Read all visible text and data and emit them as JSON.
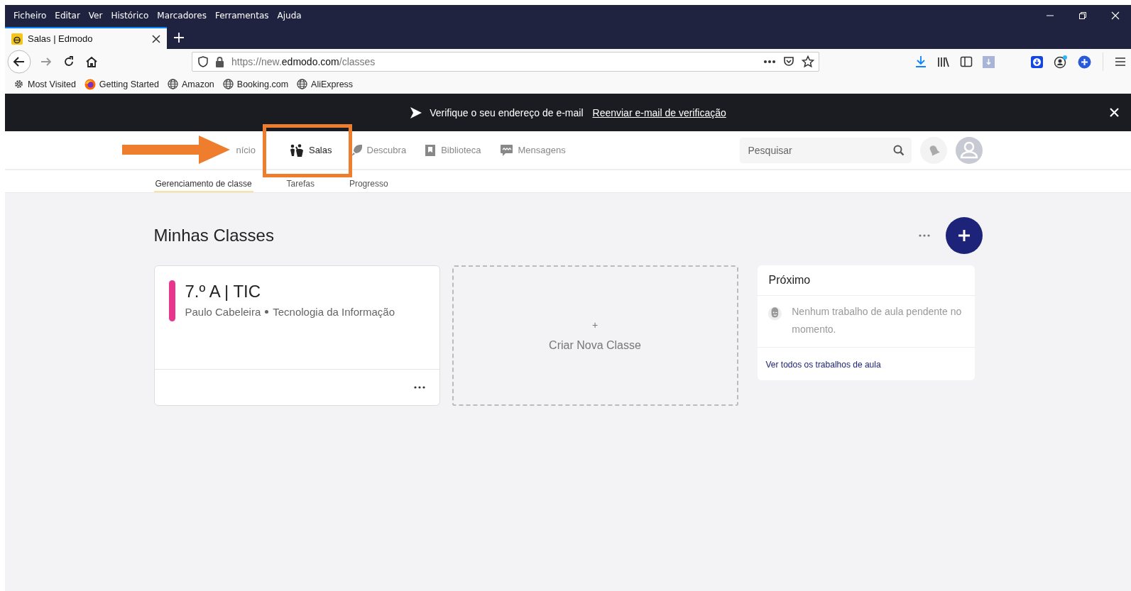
{
  "browser": {
    "menu": [
      "Ficheiro",
      "Editar",
      "Ver",
      "Histórico",
      "Marcadores",
      "Ferramentas",
      "Ajuda"
    ],
    "tab": {
      "title": "Salas | Edmodo",
      "selected": true
    },
    "url": {
      "prefix": "https://new.",
      "domain": "edmodo.com",
      "path": "/classes"
    },
    "bookmarks": [
      {
        "label": "Most Visited",
        "kind": "gear"
      },
      {
        "label": "Getting Started",
        "kind": "firefox"
      },
      {
        "label": "Amazon",
        "kind": "globe"
      },
      {
        "label": "Booking.com",
        "kind": "globe"
      },
      {
        "label": "AliExpress",
        "kind": "globe"
      }
    ]
  },
  "banner": {
    "message": "Verifique o seu endereço de e-mail",
    "link": "Reenviar e-mail de verificação"
  },
  "header": {
    "nav": [
      {
        "label": "nício",
        "selected": false,
        "highlighted": false
      },
      {
        "label": "Salas",
        "selected": true,
        "highlighted": true
      },
      {
        "label": "Descubra",
        "selected": false,
        "highlighted": false
      },
      {
        "label": "Biblioteca",
        "selected": false,
        "highlighted": false
      },
      {
        "label": "Mensagens",
        "selected": false,
        "highlighted": false
      }
    ],
    "search": {
      "placeholder": "Pesquisar"
    }
  },
  "subnav": [
    {
      "label": "Gerenciamento de classe",
      "selected": true
    },
    {
      "label": "Tarefas",
      "selected": false
    },
    {
      "label": "Progresso",
      "selected": false
    }
  ],
  "page": {
    "title": "Minhas Classes",
    "classes": [
      {
        "name": "7.º A | TIC",
        "teacher": "Paulo Cabeleira",
        "subject": "Tecnologia da Informação",
        "color": "#e8368f"
      }
    ],
    "create": {
      "icon": "+",
      "label": "Criar Nova Classe"
    }
  },
  "upcoming": {
    "title": "Próximo",
    "empty": "Nenhum trabalho de aula pendente no momento.",
    "link": "Ver todos os trabalhos de aula"
  }
}
